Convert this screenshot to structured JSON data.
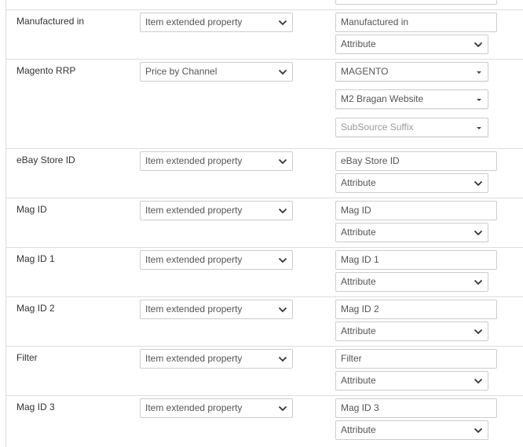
{
  "fragment_top": {
    "empty": ""
  },
  "rows": [
    {
      "label": "Manufactured in",
      "source_type": "Item extended property",
      "field_value": "Manufactured in",
      "field_kind": "Attribute"
    },
    {
      "label": "Magento RRP",
      "source_type": "Price by Channel",
      "channel": "MAGENTO",
      "website": "M2 Bragan Website",
      "suffix_placeholder": "SubSource Suffix"
    },
    {
      "label": "eBay Store ID",
      "source_type": "Item extended property",
      "field_value": "eBay Store ID",
      "field_kind": "Attribute"
    },
    {
      "label": "Mag ID",
      "source_type": "Item extended property",
      "field_value": "Mag ID",
      "field_kind": "Attribute"
    },
    {
      "label": "Mag ID 1",
      "source_type": "Item extended property",
      "field_value": "Mag ID 1",
      "field_kind": "Attribute"
    },
    {
      "label": "Mag ID 2",
      "source_type": "Item extended property",
      "field_value": "Mag ID 2",
      "field_kind": "Attribute"
    },
    {
      "label": "Filter",
      "source_type": "Item extended property",
      "field_value": "Filter",
      "field_kind": "Attribute"
    },
    {
      "label": "Mag ID 3",
      "source_type": "Item extended property",
      "field_value": "Mag ID 3",
      "field_kind": "Attribute"
    }
  ],
  "icons": {
    "select_arrow": "chevron-down-icon",
    "dropdown_caret": "caret-down-icon"
  },
  "colors": {
    "border": "#cccccc",
    "row_divider": "#dddddd",
    "text": "#333333",
    "placeholder": "#999999"
  }
}
